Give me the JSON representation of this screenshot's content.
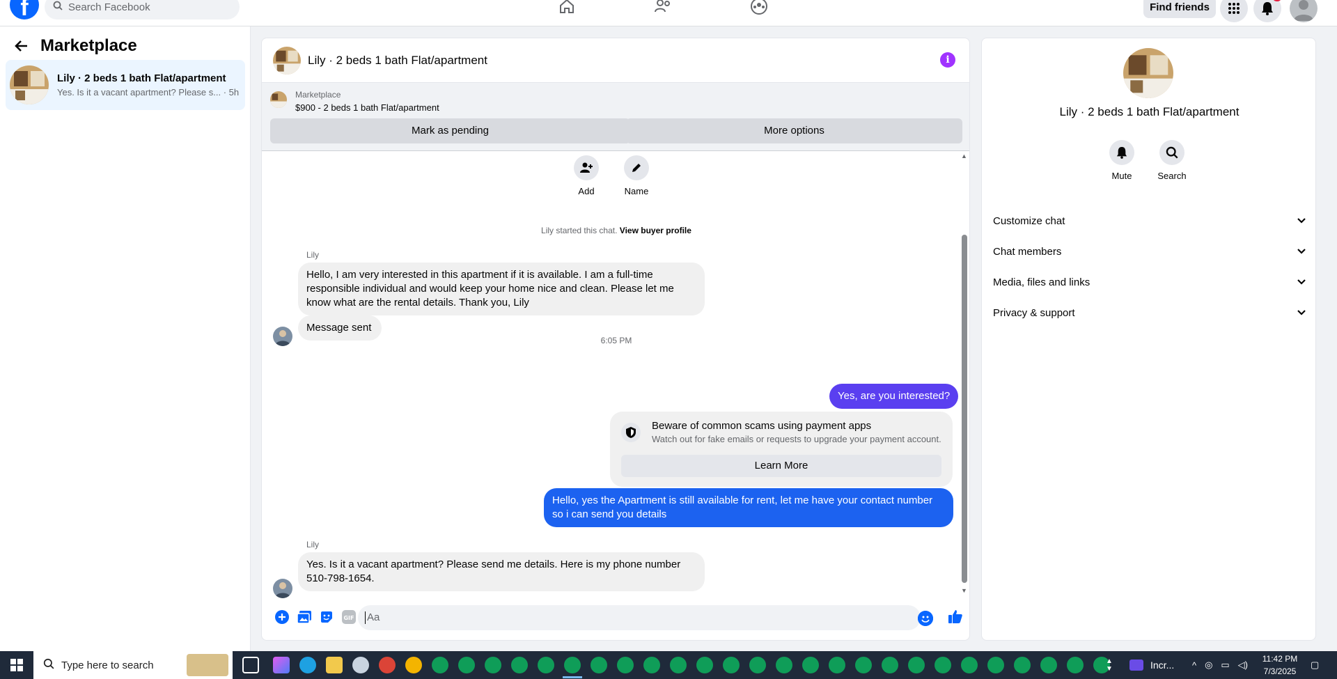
{
  "topbar": {
    "search_placeholder": "Search Facebook",
    "find_friends": "Find friends"
  },
  "left": {
    "title": "Marketplace",
    "conversation": {
      "name": "Lily · 2 beds 1 bath Flat/apartment",
      "snippet": "Yes. Is it a vacant apartment? Please s...",
      "time": "· 5h"
    }
  },
  "chat": {
    "title": "Lily · 2 beds 1 bath Flat/apartment",
    "marketplace_label": "Marketplace",
    "listing": "$900 - 2 beds 1 bath Flat/apartment",
    "mark_pending": "Mark as pending",
    "more_options": "More options",
    "actions": {
      "add": "Add",
      "name": "Name"
    },
    "started_text": "Lily started this chat.",
    "view_buyer": "View buyer profile",
    "sender1": "Lily",
    "msg1": "Hello, I am very interested in this apartment if it is available. I am a full-time responsible individual and would keep your home nice and clean. Please let me know what are the rental details. Thank you, Lily",
    "msg_sent": "Message sent",
    "time": "6:05 PM",
    "out1": "Yes, are you interested?",
    "scam_title": "Beware of common scams using payment apps",
    "scam_sub": "Watch out for fake emails or requests to upgrade your payment account.",
    "learn_more": "Learn More",
    "out2": "Hello, yes the Apartment is still available for rent, let me have your contact number so i can send you details",
    "sender2": "Lily",
    "msg2": "Yes. Is it a vacant apartment? Please send me details. Here is my phone number 510-798-1654.",
    "input_placeholder": "Aa"
  },
  "right": {
    "title": "Lily · 2 beds 1 bath Flat/apartment",
    "mute": "Mute",
    "search": "Search",
    "sections": [
      "Customize chat",
      "Chat members",
      "Media, files and links",
      "Privacy & support"
    ]
  },
  "taskbar": {
    "search_placeholder": "Type here to search",
    "inc_app": "Incr...",
    "time": "11:42 PM",
    "date": "7/3/2025"
  },
  "colors": {
    "brand": "#0866ff",
    "outgoing_purple": "#5a3ff0",
    "outgoing_blue": "#1c62f0",
    "info": "#a033ff"
  }
}
